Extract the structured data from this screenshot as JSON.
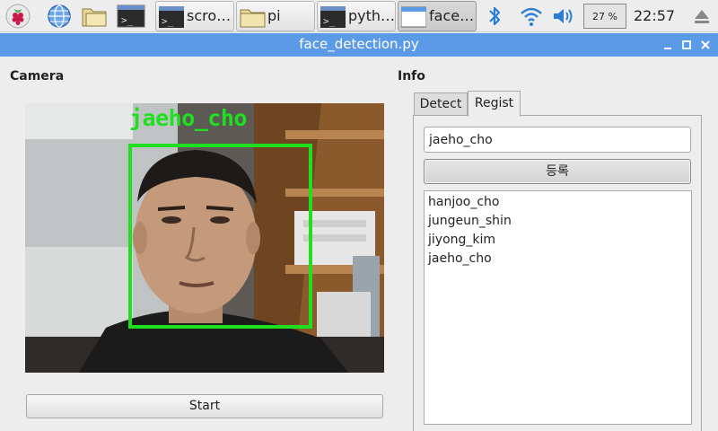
{
  "taskbar": {
    "tasks": [
      {
        "label": "scro…",
        "icon": "terminal-icon"
      },
      {
        "label": "pi",
        "icon": "folder-icon"
      },
      {
        "label": "pyth…",
        "icon": "terminal-icon"
      },
      {
        "label": "face…",
        "icon": "window-icon"
      }
    ],
    "cpu_usage": "27 %",
    "clock": "22:57"
  },
  "window": {
    "title": "face_detection.py"
  },
  "camera": {
    "section_label": "Camera",
    "detected_name": "jaeho_cho",
    "start_label": "Start"
  },
  "info": {
    "section_label": "Info",
    "tabs": [
      {
        "label": "Detect",
        "active": false
      },
      {
        "label": "Regist",
        "active": true
      }
    ],
    "name_value": "jaeho_cho",
    "register_label": "등록",
    "names": [
      "hanjoo_cho",
      "jungeun_shin",
      "jiyong_kim",
      "jaeho_cho"
    ]
  },
  "colors": {
    "titlebar": "#5b9ae6",
    "detection_box": "#1fe01f",
    "bluetooth": "#2a7fd4"
  }
}
